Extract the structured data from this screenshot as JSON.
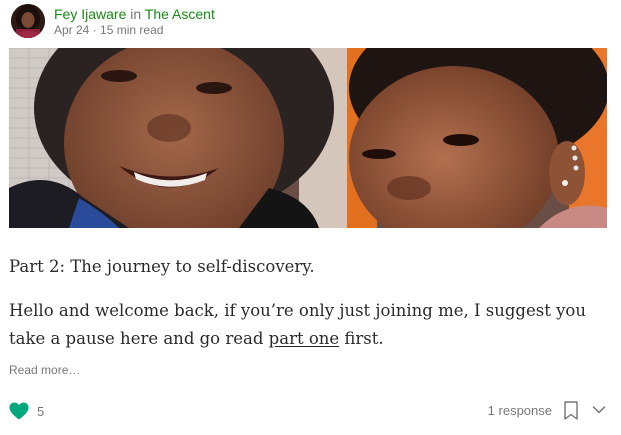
{
  "post": {
    "author": "Fey Ijaware",
    "in_word": "in",
    "publication": "The Ascent",
    "date": "Apr 24",
    "separator": "·",
    "read_time": "15 min read",
    "subtitle": "Part 2: The journey to self-discovery.",
    "excerpt_before": "Hello and welcome back, if you’re only just joining me, I suggest you take a pause here and go read ",
    "excerpt_link": "part one",
    "excerpt_after": " first.",
    "read_more": "Read more…"
  },
  "footer": {
    "clap_count": "5",
    "responses": "1 response"
  },
  "icons": {
    "clap": "heart-icon",
    "bookmark": "bookmark-icon",
    "more": "chevron-down-icon"
  },
  "colors": {
    "accent_green": "#1a8917",
    "clap_green": "#03a87c",
    "muted_text": "#757575"
  }
}
